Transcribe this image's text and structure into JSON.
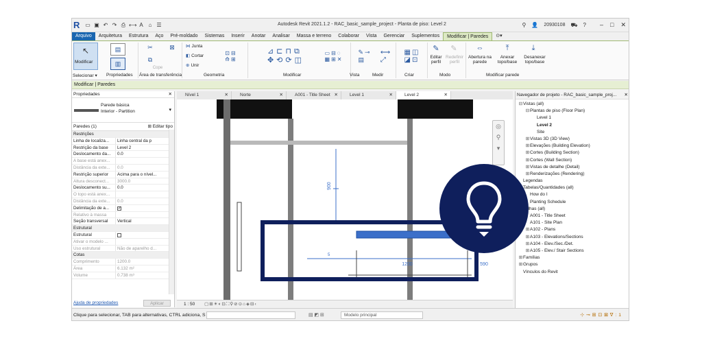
{
  "titlebar": {
    "logo": "R",
    "app_title": "Autodesk Revit 2021.1.2 - RAC_basic_sample_project - Planta de piso: Level 2",
    "user": "20930108"
  },
  "ribbon_tabs": [
    "Arquivo",
    "Arquitetura",
    "Estrutura",
    "Aço",
    "Pré-moldado",
    "Sistemas",
    "Inserir",
    "Anotar",
    "Analisar",
    "Massa e terreno",
    "Colaborar",
    "Vista",
    "Gerenciar",
    "Suplementos",
    "Modificar | Paredes"
  ],
  "ribbon": {
    "modify_label": "Modificar",
    "join_label": "Junta",
    "cut_label": "Cortar",
    "unite_label": "Unir",
    "cope_label": "Cope",
    "edit_profile": "Editar perfil",
    "reset_profile": "Redefinir perfil",
    "wall_opening": "Abertura na parede",
    "attach": "Anexar topo/base",
    "detach": "Desanexar topo/base",
    "panels": {
      "select": "Selecionar ▾",
      "properties": "Propriedades",
      "clipboard": "Área de transferência",
      "geometry": "Geometria",
      "modify": "Modificar",
      "view": "Vista",
      "measure": "Medir",
      "create": "Criar",
      "mode": "Modo",
      "modify_wall": "Modificar parede"
    }
  },
  "context_bar": "Modificar | Paredes",
  "properties": {
    "header": "Propriedades",
    "type_line1": "Parede básica",
    "type_line2": "Interior - Partition",
    "instance": "Paredes (1)",
    "edit_type": "Editar tipo",
    "rows": [
      {
        "k": "Restrições",
        "v": "",
        "group": true
      },
      {
        "k": "Linha de localiza...",
        "v": "Linha central da p"
      },
      {
        "k": "Restrição da base",
        "v": "Level 2"
      },
      {
        "k": "Deslocamento da...",
        "v": "0.0"
      },
      {
        "k": "A base está anex...",
        "v": "",
        "dis": true
      },
      {
        "k": "Distância da exte...",
        "v": "0.0",
        "dis": true
      },
      {
        "k": "Restrição superior",
        "v": "Acima para o nível..."
      },
      {
        "k": "Altura desconect...",
        "v": "3000.0",
        "dis": true
      },
      {
        "k": "Deslocamento su...",
        "v": "0.0"
      },
      {
        "k": "O topo está anex...",
        "v": "",
        "dis": true
      },
      {
        "k": "Distância da exte...",
        "v": "0.0",
        "dis": true
      },
      {
        "k": "Delimitação de a...",
        "v": "",
        "check": true
      },
      {
        "k": "Relativo à massa",
        "v": "",
        "dis": true
      },
      {
        "k": "Seção transversal",
        "v": "Vertical"
      },
      {
        "k": "Estrutural",
        "v": "",
        "group": true
      },
      {
        "k": "Estrutural",
        "v": "",
        "check": false
      },
      {
        "k": "Ativar o modelo ...",
        "v": "",
        "dis": true
      },
      {
        "k": "Uso estrutural",
        "v": "Não de aparelho d...",
        "dis": true
      },
      {
        "k": "Cotas",
        "v": "",
        "group": true
      },
      {
        "k": "Comprimento",
        "v": "1200.0",
        "dis": true
      },
      {
        "k": "Área",
        "v": "6.132 m²",
        "dis": true
      },
      {
        "k": "Volume",
        "v": "0.738 m³",
        "dis": true
      }
    ],
    "help_link": "Ajuda de propriedades",
    "apply": "Aplicar"
  },
  "view_tabs": [
    "Nível 1",
    "Norte",
    "A001 - Title Sheet",
    "Level 1",
    "Level 2"
  ],
  "canvas": {
    "dim_vertical": "900",
    "dim_a": "1200",
    "dim_b": "590",
    "dim_small": "5"
  },
  "view_scale": "1 : 50",
  "browser": {
    "header": "Navegador de projeto - RAC_basic_sample_proj...",
    "items": [
      {
        "t": "Vistas (all)",
        "lvl": 0,
        "tg": "⊟"
      },
      {
        "t": "Plantas de piso (Floor Plan)",
        "lvl": 1,
        "tg": "⊟"
      },
      {
        "t": "Level 1",
        "lvl": 2,
        "tg": ""
      },
      {
        "t": "Level 2",
        "lvl": 2,
        "tg": "",
        "bold": true
      },
      {
        "t": "Site",
        "lvl": 2,
        "tg": ""
      },
      {
        "t": "Vistas 3D (3D View)",
        "lvl": 1,
        "tg": "⊞"
      },
      {
        "t": "Elevações (Building Elevation)",
        "lvl": 1,
        "tg": "⊞"
      },
      {
        "t": "Cortes (Building Section)",
        "lvl": 1,
        "tg": "⊞"
      },
      {
        "t": "Cortes (Wall Section)",
        "lvl": 1,
        "tg": "⊞"
      },
      {
        "t": "Vistas de detalhe (Detail)",
        "lvl": 1,
        "tg": "⊞"
      },
      {
        "t": "Renderizações (Rendering)",
        "lvl": 1,
        "tg": "⊞"
      },
      {
        "t": "Legendas",
        "lvl": 0,
        "tg": ""
      },
      {
        "t": "Tabelas/Quantidades (all)",
        "lvl": 0,
        "tg": ""
      },
      {
        "t": "How do I",
        "lvl": 1,
        "tg": ""
      },
      {
        "t": "Planting Schedule",
        "lvl": 1,
        "tg": ""
      },
      {
        "t": "Folhas (all)",
        "lvl": 0,
        "tg": ""
      },
      {
        "t": "A001 - Title Sheet",
        "lvl": 1,
        "tg": ""
      },
      {
        "t": "A101 - Site Plan",
        "lvl": 1,
        "tg": ""
      },
      {
        "t": "A102 - Plans",
        "lvl": 1,
        "tg": "⊞"
      },
      {
        "t": "A103 - Elevations/Sections",
        "lvl": 1,
        "tg": "⊞"
      },
      {
        "t": "A104 - Elev./Sec./Det.",
        "lvl": 1,
        "tg": "⊞"
      },
      {
        "t": "A105 - Elev./ Stair Sections",
        "lvl": 1,
        "tg": "⊞"
      },
      {
        "t": "Famílias",
        "lvl": 0,
        "tg": "⊞"
      },
      {
        "t": "Grupos",
        "lvl": 0,
        "tg": "⊞"
      },
      {
        "t": "Vínculos do Revit",
        "lvl": 0,
        "tg": ""
      }
    ]
  },
  "status": {
    "hint": "Clique para selecionar, TAB para alternativas, CTRL adiciona, S",
    "model": "Modelo principal",
    "filter": "∇:1"
  },
  "colors": {
    "overlay": "#0f1f5c",
    "file_tab": "#1a66b0",
    "context": "#e6efd3"
  }
}
